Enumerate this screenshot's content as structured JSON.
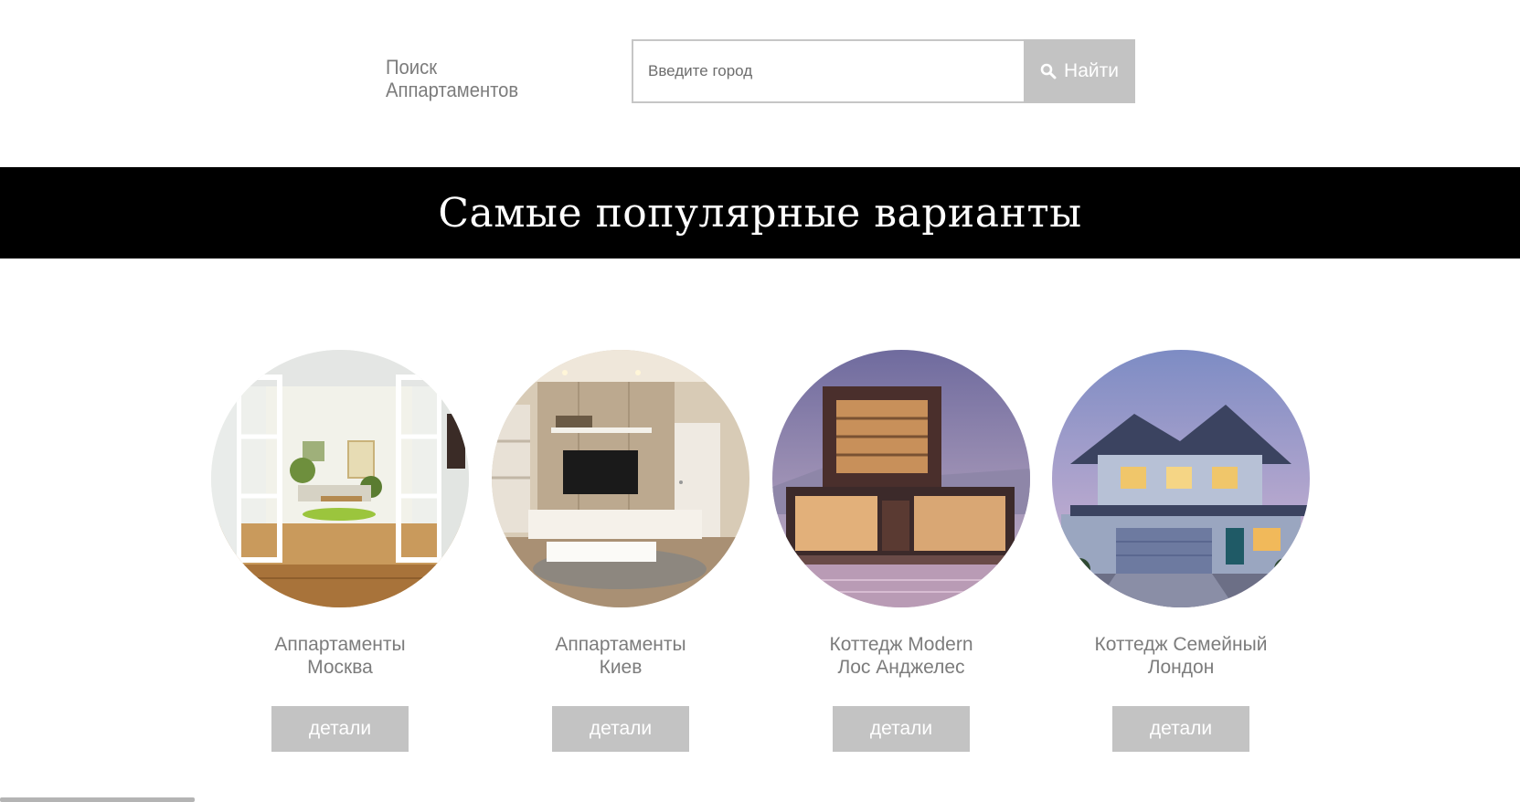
{
  "header": {
    "logo_line1": "Поиск",
    "logo_line2": "Аппартаментов",
    "search": {
      "placeholder": "Введите город",
      "value": "",
      "button_label": "Найти",
      "button_icon": "search-icon"
    }
  },
  "banner": {
    "title": "Самые популярные варианты"
  },
  "cards": [
    {
      "title_line1": "Аппартаменты",
      "title_line2": "Москва",
      "button_label": "детали",
      "image": "bright interior with open glass doors and wooden floor"
    },
    {
      "title_line1": "Аппартаменты",
      "title_line2": "Киев",
      "button_label": "детали",
      "image": "living room with TV wall and shelves"
    },
    {
      "title_line1": "Коттедж Modern",
      "title_line2": "Лос Анджелес",
      "button_label": "детали",
      "image": "modern cube house at dusk with pool"
    },
    {
      "title_line1": "Коттедж Семейный",
      "title_line2": "Лондон",
      "button_label": "детали",
      "image": "two-storey family house with garage at twilight"
    }
  ],
  "colors": {
    "accent_gray": "#c3c3c3",
    "text_gray": "#7c7c7c",
    "banner_bg": "#000000"
  }
}
